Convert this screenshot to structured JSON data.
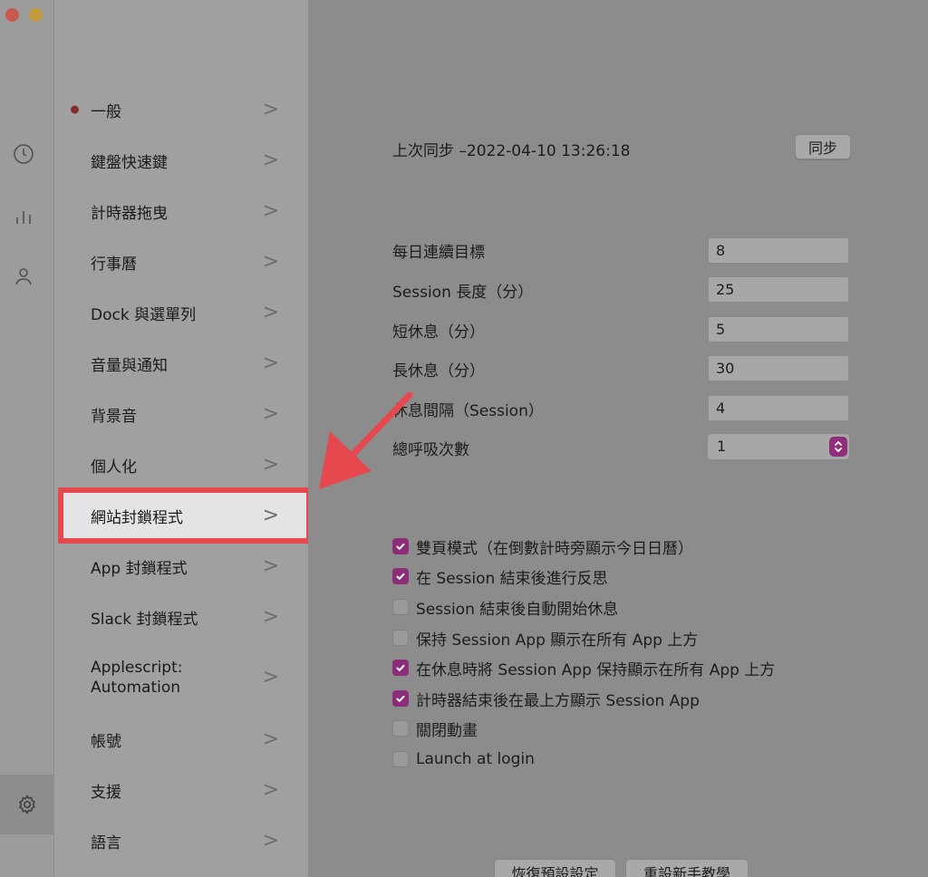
{
  "sidebar": {
    "menu_items": [
      {
        "label": "一般",
        "active": true
      },
      {
        "label": "鍵盤快速鍵"
      },
      {
        "label": "計時器拖曳"
      },
      {
        "label": "行事曆"
      },
      {
        "label": "Dock 與選單列"
      },
      {
        "label": "音量與通知"
      },
      {
        "label": "背景音"
      },
      {
        "label": "個人化"
      },
      {
        "label": "網站封鎖程式",
        "highlighted": true
      },
      {
        "label": "App 封鎖程式"
      },
      {
        "label": "Slack 封鎖程式"
      },
      {
        "label": "Applescript:\nAutomation",
        "line1": "Applescript:",
        "line2": "Automation"
      },
      {
        "label": "帳號"
      },
      {
        "label": "支援"
      },
      {
        "label": "語言"
      }
    ],
    "chevron": ">"
  },
  "sync": {
    "text": "上次同步 –2022-04-10 13:26:18",
    "button_label": "同步"
  },
  "settings": [
    {
      "label": "每日連續目標",
      "value": "8"
    },
    {
      "label": "Session 長度（分）",
      "value": "25"
    },
    {
      "label": "短休息（分）",
      "value": "5"
    },
    {
      "label": "長休息（分）",
      "value": "30"
    },
    {
      "label": "休息間隔（Session）",
      "value": "4"
    }
  ],
  "breath": {
    "label": "總呼吸次數",
    "selected": "1"
  },
  "checkboxes": [
    {
      "label": "雙頁模式（在倒數計時旁顯示今日日曆）",
      "checked": true
    },
    {
      "label": "在 Session 結束後進行反思",
      "checked": true
    },
    {
      "label": "Session 結束後自動開始休息",
      "checked": false
    },
    {
      "label": "保持 Session App 顯示在所有 App  上方",
      "checked": false
    },
    {
      "label": "在休息時將 Session App 保持顯示在所有 App  上方",
      "checked": true
    },
    {
      "label": "計時器結束後在最上方顯示 Session App",
      "checked": true
    },
    {
      "label": "關閉動畫",
      "checked": false
    },
    {
      "label": "Launch at login",
      "checked": false
    }
  ],
  "footer": {
    "reset_defaults": "恢復預設設定",
    "reset_tutorial": "重設新手教學"
  },
  "colors": {
    "accent": "#8b2d78",
    "annotation": "#e5484d",
    "active_dot": "#8a2a2a"
  }
}
